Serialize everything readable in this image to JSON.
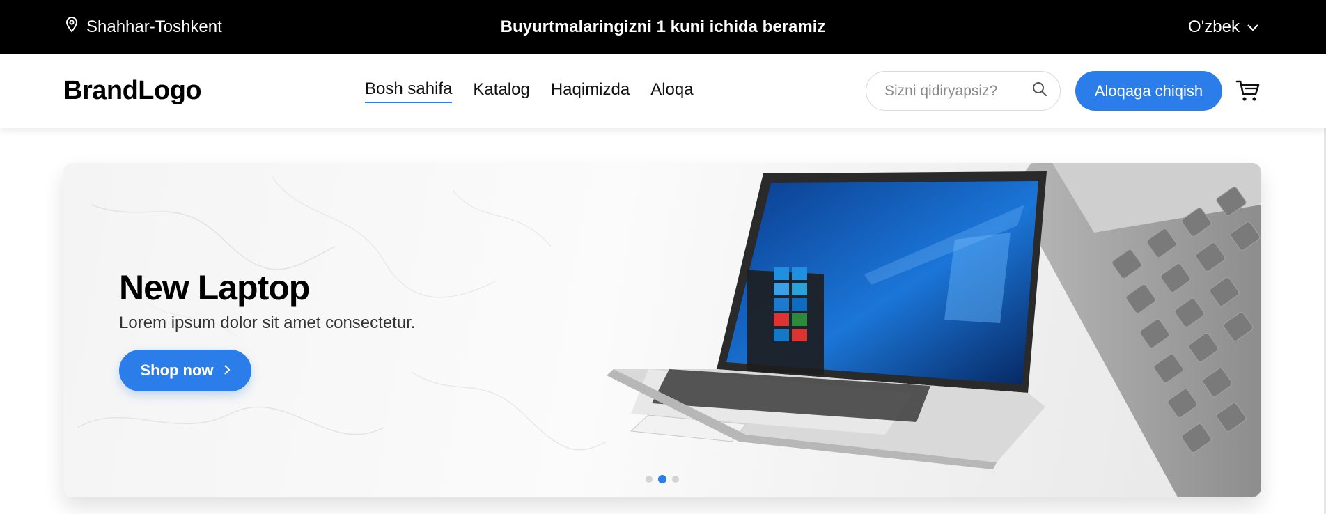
{
  "topbar": {
    "location": "Shahhar-Toshkent",
    "promo": "Buyurtmalaringizni 1 kuni ichida beramiz",
    "language": "O'zbek"
  },
  "header": {
    "logo": "BrandLogo",
    "nav": [
      {
        "label": "Bosh sahifa",
        "active": true
      },
      {
        "label": "Katalog",
        "active": false
      },
      {
        "label": "Haqimizda",
        "active": false
      },
      {
        "label": "Aloqa",
        "active": false
      }
    ],
    "search_placeholder": "Sizni qidiryapsiz?",
    "contact_button": "Aloqaga chiqish"
  },
  "hero": {
    "title": "New Laptop",
    "subtitle": "Lorem ipsum dolor sit amet consectetur.",
    "button": "Shop now",
    "slides_count": 3,
    "active_slide": 2
  },
  "icons": [
    "location-pin-icon",
    "chevron-down-icon",
    "search-icon",
    "cart-icon",
    "chevron-right-icon"
  ],
  "colors": {
    "accent": "#2b7de9",
    "topbar_bg": "#000000",
    "text": "#111111"
  }
}
